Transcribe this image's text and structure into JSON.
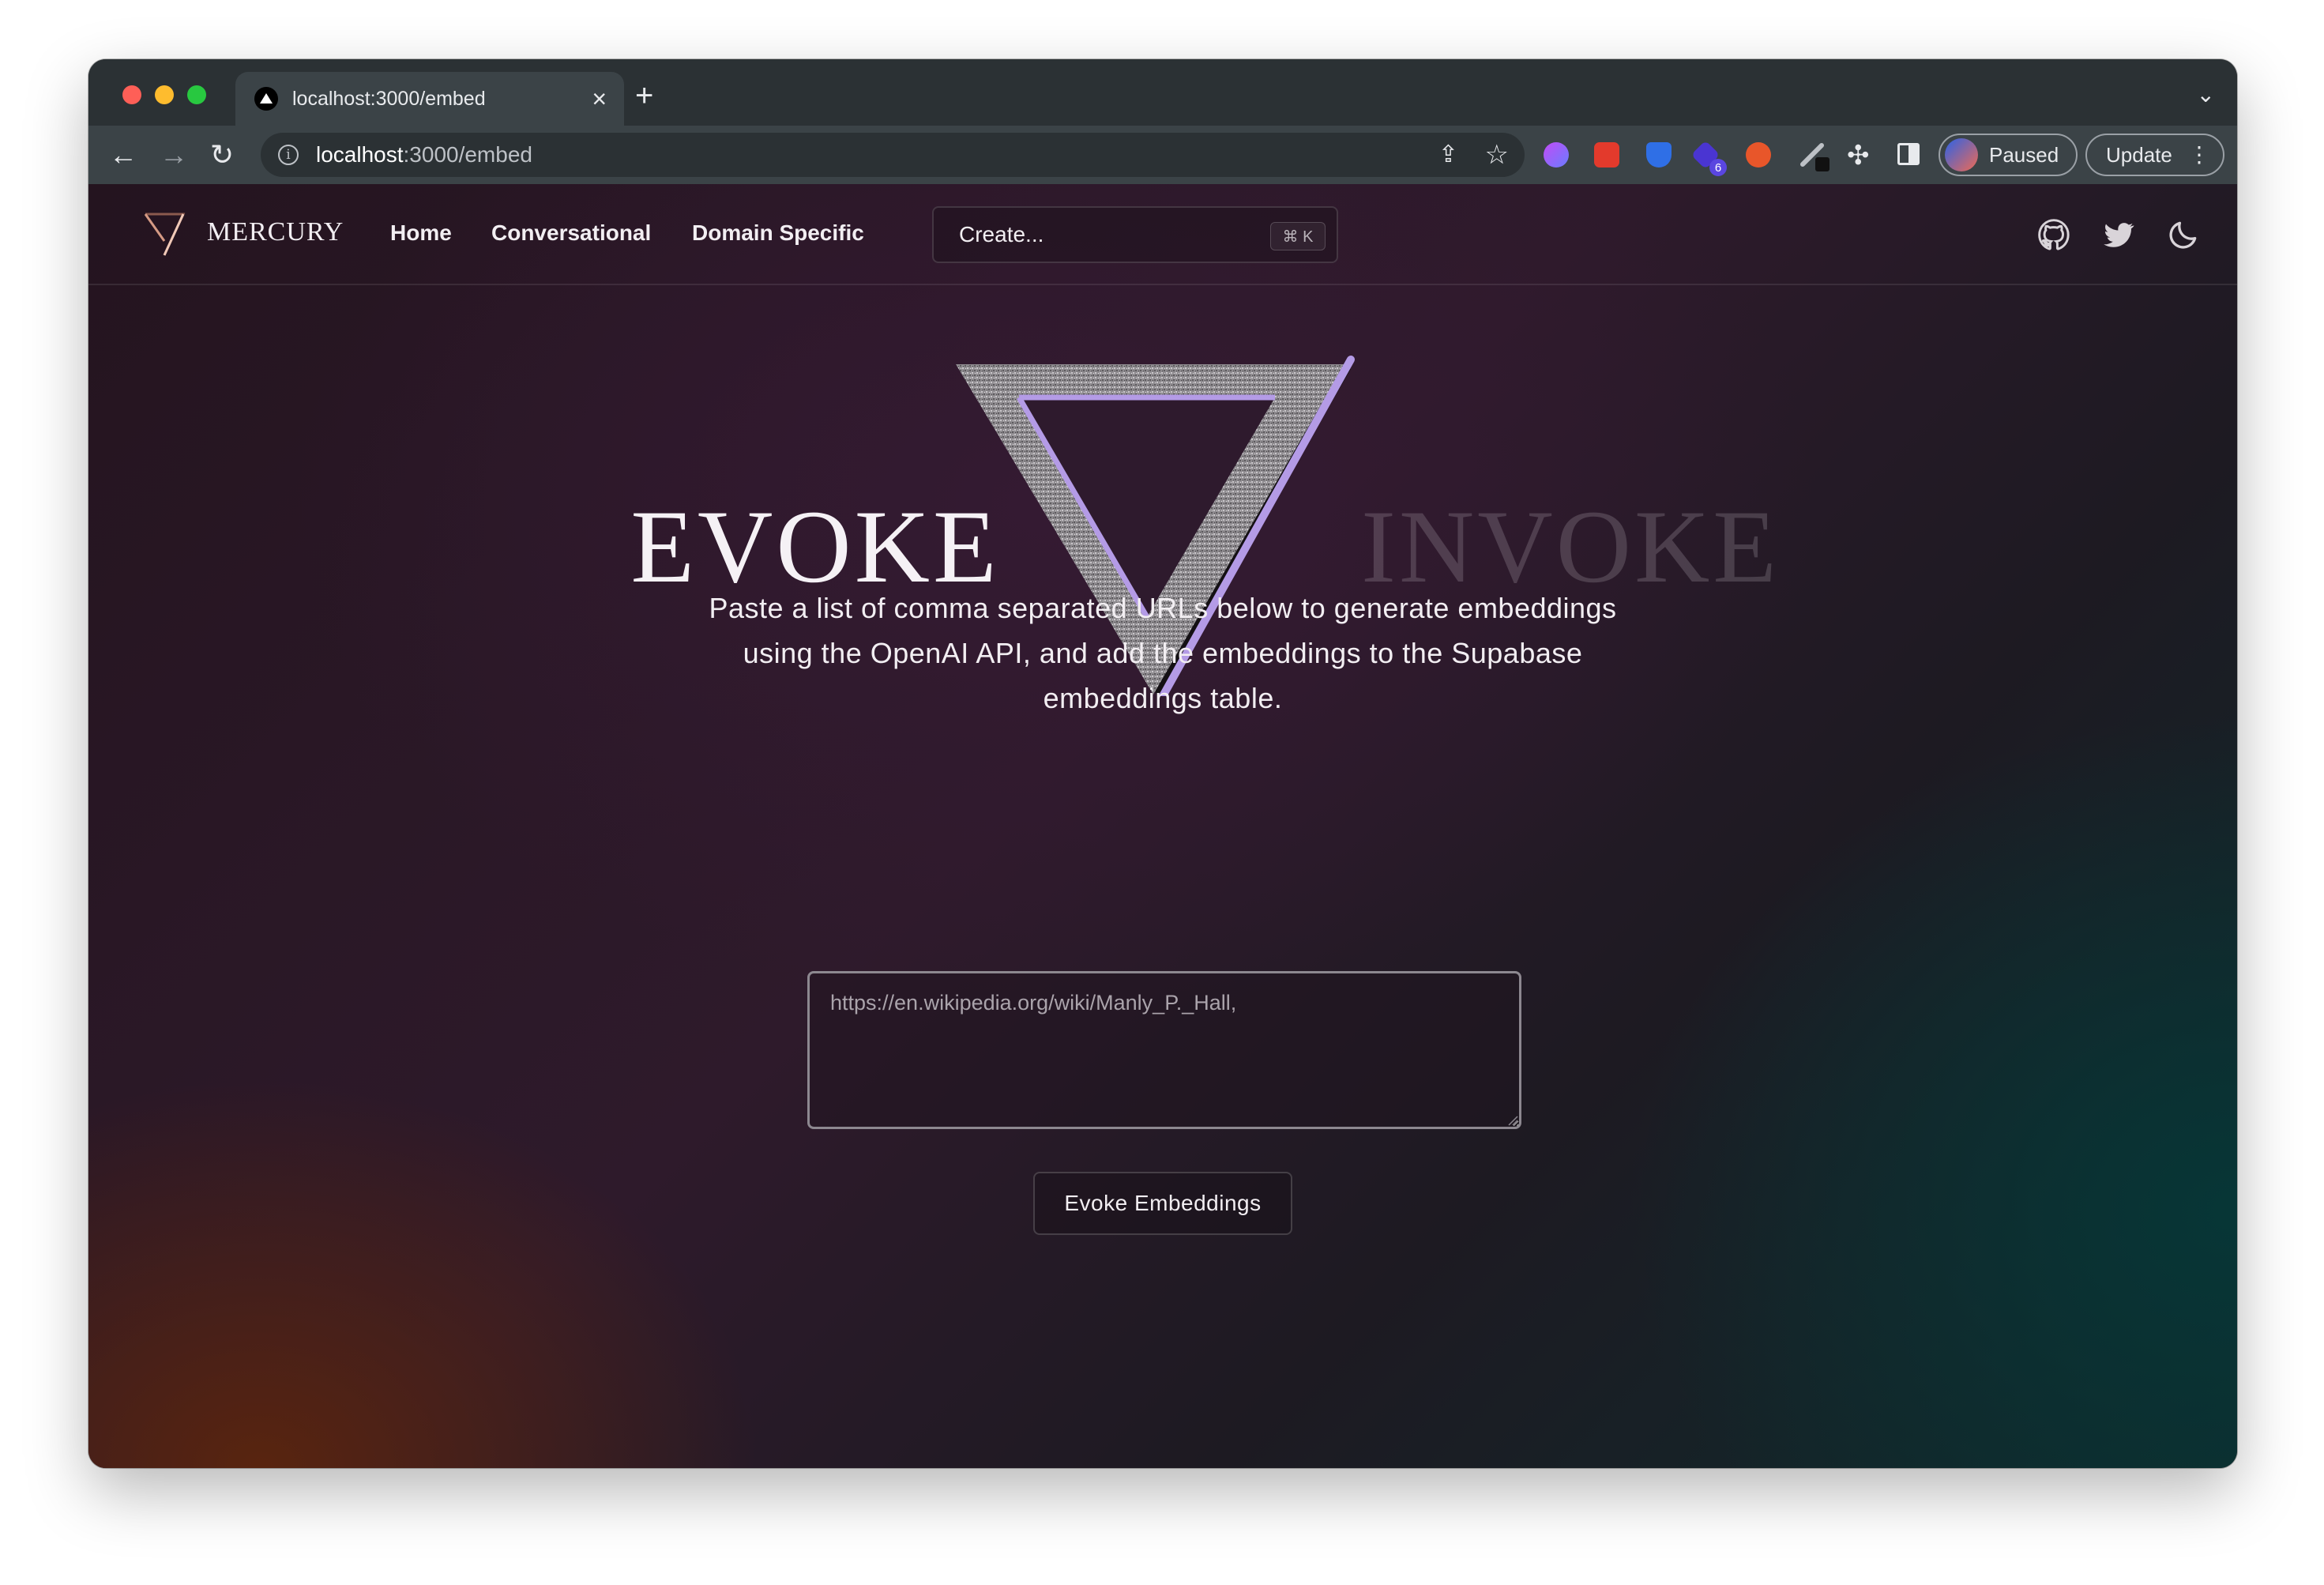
{
  "browser": {
    "tab_title": "localhost:3000/embed",
    "new_tab_label": "+",
    "address_host": "localhost",
    "address_path": ":3000/embed",
    "profile_label": "Paused",
    "update_label": "Update",
    "extension_badge_count": "6"
  },
  "nav": {
    "brand": "MERCURY",
    "links": [
      "Home",
      "Conversational",
      "Domain Specific"
    ],
    "create_label": "Create...",
    "shortcut": "⌘ K"
  },
  "hero": {
    "left_word": "EVOKE",
    "right_word": "INVOKE",
    "description": "Paste a list of comma separated URLs below to generate embeddings using the OpenAI API, and add the embeddings to the Supabase embeddings table."
  },
  "form": {
    "urls_placeholder": "https://en.wikipedia.org/wiki/Manly_P._Hall,",
    "urls_value": "",
    "submit_label": "Evoke Embeddings"
  },
  "colors": {
    "accent_purple": "#b49be6",
    "page_bg": "#2e1a2b"
  }
}
